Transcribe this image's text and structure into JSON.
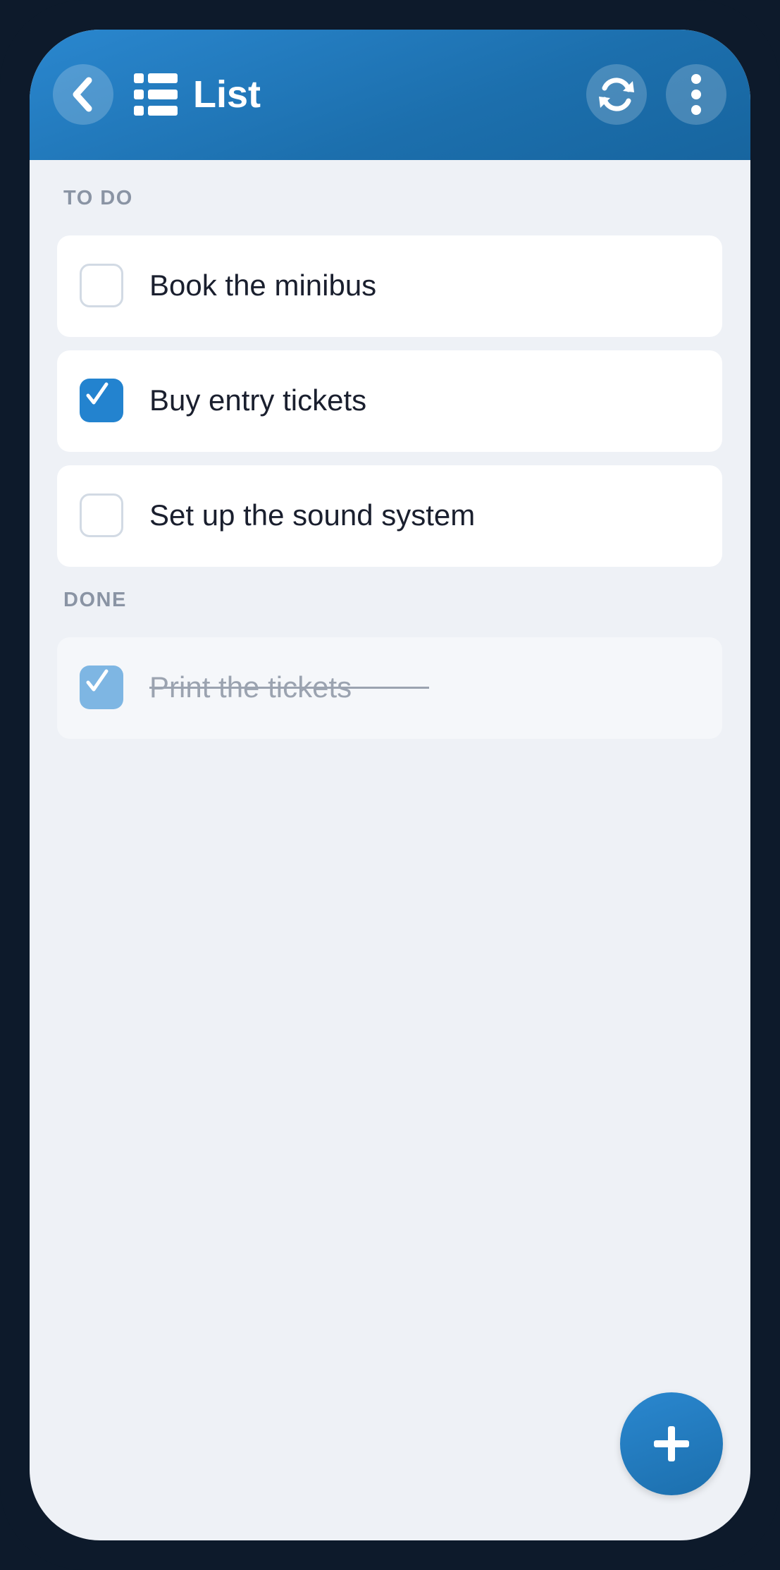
{
  "header": {
    "title": "List",
    "back_icon": "chevron-left-icon",
    "list_icon": "list-icon",
    "sync_icon": "sync-icon",
    "more_icon": "more-vertical-icon"
  },
  "sections": {
    "todo_label": "TO DO",
    "done_label": "DONE"
  },
  "todo_items": [
    {
      "text": "Book the minibus",
      "checked": false
    },
    {
      "text": "Buy entry tickets",
      "checked": true
    },
    {
      "text": "Set up the sound system",
      "checked": false
    }
  ],
  "done_items": [
    {
      "text": "Print the tickets",
      "checked": true
    }
  ],
  "fab": {
    "icon": "plus-icon"
  },
  "colors": {
    "accent": "#2383cf",
    "header_start": "#2a87cf",
    "header_end": "#17659f",
    "background": "#eef1f6",
    "device_frame": "#0d1a2b"
  }
}
